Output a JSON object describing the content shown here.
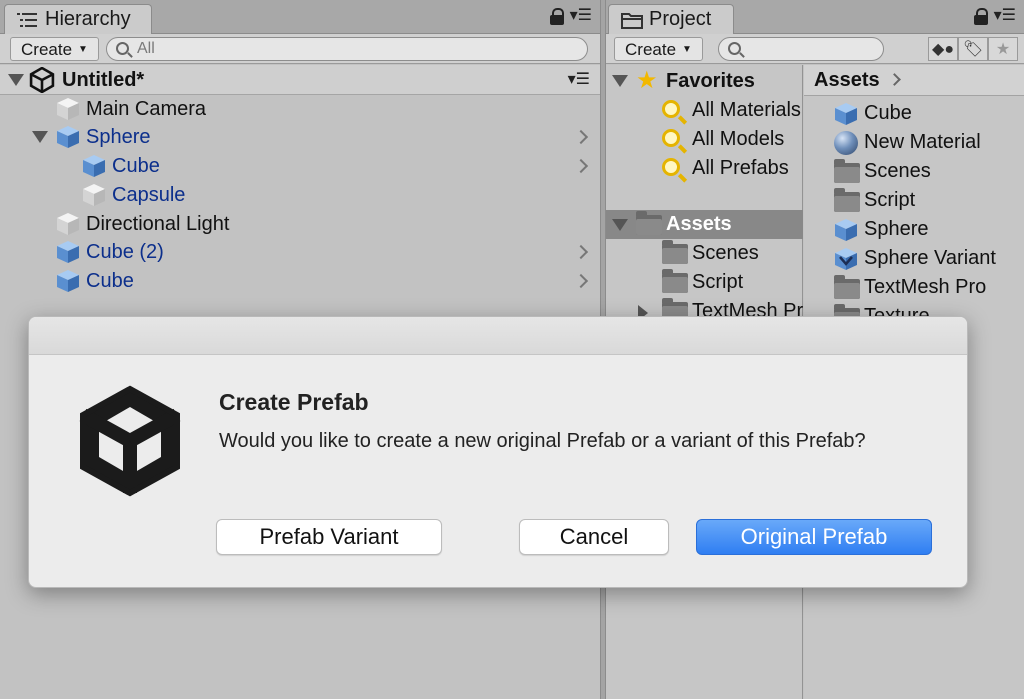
{
  "hierarchy": {
    "tab_label": "Hierarchy",
    "create_label": "Create",
    "search_placeholder": "All",
    "scene_name": "Untitled*",
    "items": [
      {
        "label": "Main Camera",
        "prefab": false,
        "icon": "gray-cube-icon"
      },
      {
        "label": "Sphere",
        "prefab": true,
        "icon": "blue-cube-icon",
        "expanded": true
      },
      {
        "label": "Cube",
        "prefab": true,
        "icon": "blue-cube-icon"
      },
      {
        "label": "Capsule",
        "prefab": true,
        "icon": "gray-cube-icon"
      },
      {
        "label": "Directional Light",
        "prefab": false,
        "icon": "gray-cube-icon"
      },
      {
        "label": "Cube (2)",
        "prefab": true,
        "icon": "blue-cube-icon"
      },
      {
        "label": "Cube",
        "prefab": true,
        "icon": "blue-cube-icon"
      }
    ]
  },
  "project": {
    "tab_label": "Project",
    "create_label": "Create",
    "favorites_label": "Favorites",
    "favorites": [
      "All Materials",
      "All Models",
      "All Prefabs"
    ],
    "assets_label": "Assets",
    "asset_folders": [
      "Scenes",
      "Script",
      "TextMesh Pro"
    ],
    "breadcrumb": "Assets",
    "assets": [
      {
        "label": "Cube",
        "icon": "blue-cube-icon"
      },
      {
        "label": "New Material",
        "icon": "sphere-material-icon"
      },
      {
        "label": "Scenes",
        "icon": "folder-icon"
      },
      {
        "label": "Script",
        "icon": "folder-icon"
      },
      {
        "label": "Sphere",
        "icon": "blue-cube-icon"
      },
      {
        "label": "Sphere Variant",
        "icon": "prefab-variant-icon"
      },
      {
        "label": "TextMesh Pro",
        "icon": "folder-icon"
      },
      {
        "label": "Texture",
        "icon": "folder-icon"
      }
    ]
  },
  "dialog": {
    "title": "Create Prefab",
    "message": "Would you like to create a new original Prefab or a variant of this Prefab?",
    "buttons": {
      "variant": "Prefab Variant",
      "cancel": "Cancel",
      "original": "Original Prefab"
    }
  },
  "colors": {
    "prefab_text": "#0c2f8c",
    "primary_button": "#2f7ef2",
    "selection": "#888888"
  }
}
